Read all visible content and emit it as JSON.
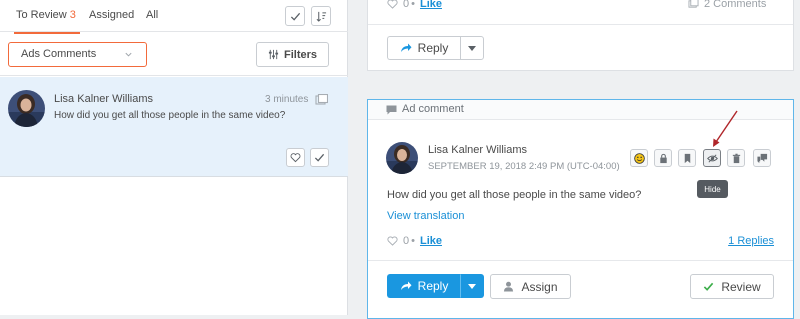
{
  "queue": {
    "tabs": [
      {
        "label": "To Review",
        "count": "3"
      },
      {
        "label": "Assigned"
      },
      {
        "label": "All"
      }
    ],
    "filter_select": {
      "value": "Ads Comments"
    },
    "filters_label": "Filters",
    "items": [
      {
        "name": "Lisa Kalner Williams",
        "time": "3 minutes",
        "text": "How did you get all those people in the same video?"
      }
    ]
  },
  "top_card": {
    "like_count": "0",
    "like_label": "Like",
    "comments_label": "2 Comments",
    "reply_label": "Reply"
  },
  "comment_card": {
    "header": "Ad comment",
    "author": "Lisa Kalner Williams",
    "date": "SEPTEMBER 19, 2018 2:49 PM (UTC-04:00)",
    "text": "How did you get all those people in the same video?",
    "translate_label": "View translation",
    "like_count": "0",
    "like_label": "Like",
    "replies_label": "1 Replies",
    "tooltip": "Hide",
    "reply_label": "Reply",
    "assign_label": "Assign",
    "review_label": "Review",
    "actions": [
      "smiley-icon",
      "lock-icon",
      "bookmark-icon",
      "hide-eye-icon",
      "trash-icon",
      "message-icon"
    ]
  },
  "colors": {
    "accent_orange": "#f26a3b",
    "primary_blue": "#1a97e0",
    "link_blue": "#1a8fd6",
    "selected_row": "#e6f1fb",
    "annotation_arrow": "#b0262a",
    "review_check": "#3cae4a"
  }
}
